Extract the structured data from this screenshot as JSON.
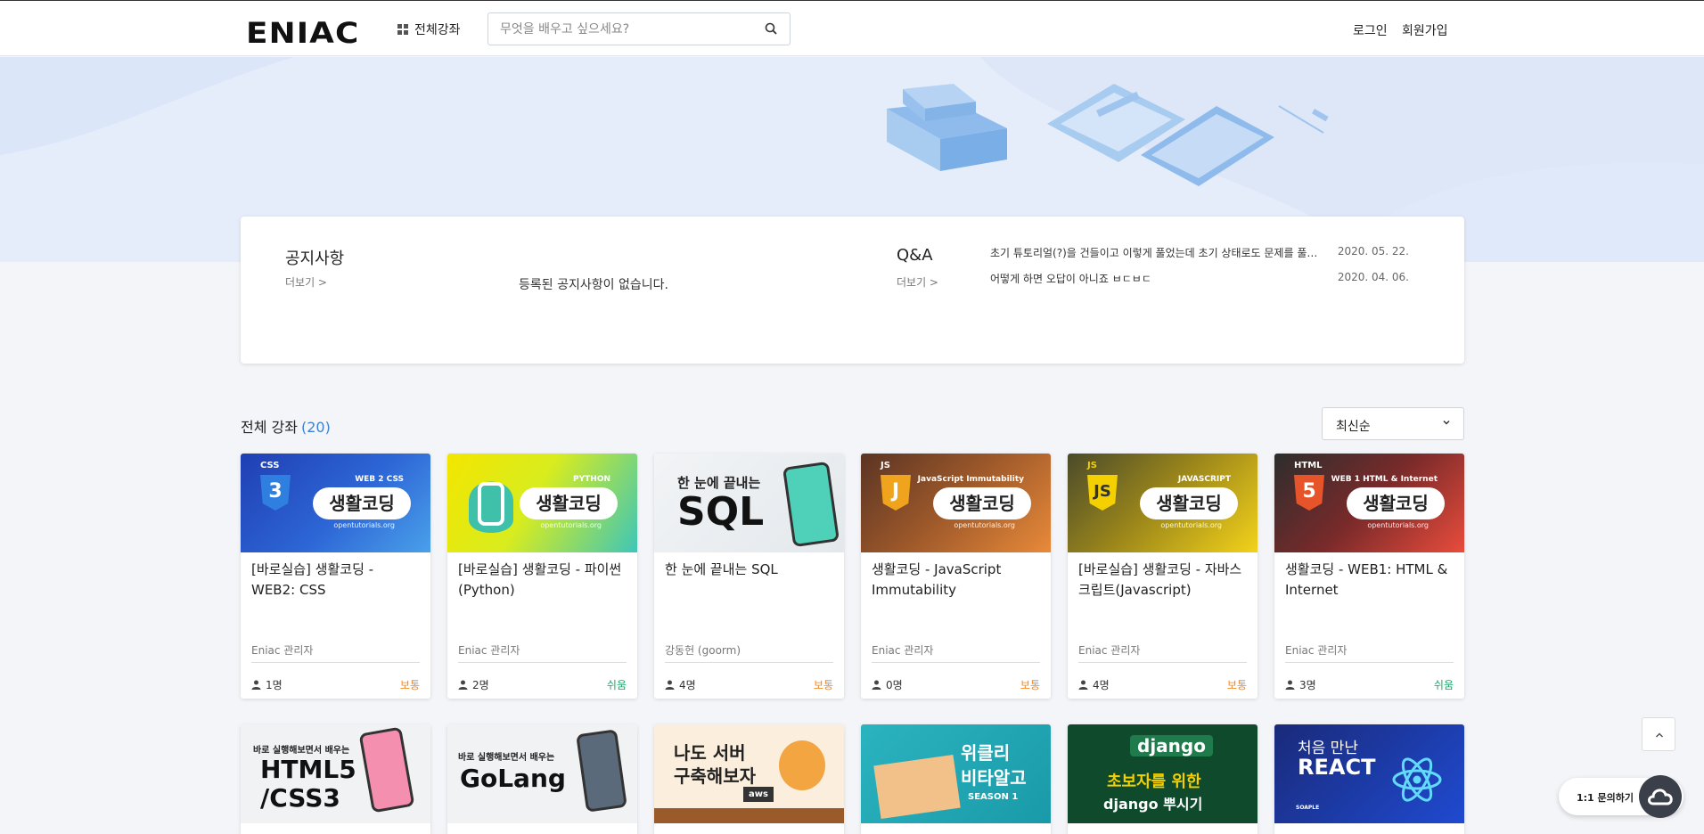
{
  "header": {
    "logo": "ENIAC",
    "all_courses_label": "전체강좌",
    "search_placeholder": "무엇을 배우고 싶으세요?",
    "login_label": "로그인",
    "signup_label": "회원가입"
  },
  "notice": {
    "title": "공지사항",
    "more_label": "더보기  >",
    "empty_message": "등록된 공지사항이 없습니다."
  },
  "qa": {
    "title": "Q&A",
    "more_label": "더보기  >",
    "items": [
      {
        "title": "초기 튜토리얼(?)을 건들이고 이렇게 풀었는데 초기 상태로도 문제를 풀 수 있나요?",
        "date": "2020. 05. 22."
      },
      {
        "title": "어떻게 하면 오답이 아니죠 ㅂㄷㅂㄷ",
        "date": "2020. 04. 06."
      }
    ]
  },
  "courses": {
    "section_title": "전체 강좌",
    "count": "(20)",
    "sort_label": "최신순",
    "items": [
      {
        "title": "[바로실습] 생활코딩 - WEB2: CSS",
        "author": "Eniac 관리자",
        "students": "1명",
        "level": "보통",
        "level_color": "#f08a24",
        "thumb": {
          "badge": "CSS",
          "glyph": "3",
          "sup": "WEB 2  CSS",
          "pill": "생활코딩",
          "sub": "opentutorials.org"
        }
      },
      {
        "title": "[바로실습] 생활코딩 - 파이썬 (Python)",
        "author": "Eniac 관리자",
        "students": "2명",
        "level": "쉬움",
        "level_color": "#1aa86a",
        "thumb": {
          "sup": "PYTHON",
          "pill": "생활코딩",
          "sub": "opentutorials.org"
        }
      },
      {
        "title": "한 눈에 끝내는 SQL",
        "author": "강동헌 (goorm)",
        "students": "4명",
        "level": "보통",
        "level_color": "#f08a24",
        "thumb": {
          "line1": "한 눈에 끝내는",
          "line2": "SQL"
        }
      },
      {
        "title": "생활코딩 - JavaScript Immutability",
        "author": "Eniac 관리자",
        "students": "0명",
        "level": "보통",
        "level_color": "#f08a24",
        "thumb": {
          "badge": "JS",
          "glyph": "J",
          "sup": "JavaScript  Immutability",
          "pill": "생활코딩",
          "sub": "opentutorials.org"
        }
      },
      {
        "title": "[바로실습] 생활코딩 - 자바스크립트(Javascript)",
        "author": "Eniac 관리자",
        "students": "4명",
        "level": "보통",
        "level_color": "#f08a24",
        "thumb": {
          "badge": "JS",
          "glyph": "JS",
          "sup": "JAVASCRIPT",
          "pill": "생활코딩",
          "sub": "opentutorials.org"
        }
      },
      {
        "title": "생활코딩 - WEB1: HTML & Internet",
        "author": "Eniac 관리자",
        "students": "3명",
        "level": "쉬움",
        "level_color": "#1aa86a",
        "thumb": {
          "badge": "HTML",
          "glyph": "5",
          "sup": "WEB 1  HTML & Internet",
          "pill": "생활코딩",
          "sub": "opentutorials.org"
        }
      }
    ],
    "row2": [
      {
        "line1": "바로 실행해보면서 배우는",
        "line2": "HTML5",
        "line3": "/CSS3"
      },
      {
        "line1": "바로 실행해보면서 배우는",
        "line2": "GoLang"
      },
      {
        "line1": "나도 서버",
        "line2": "구축해보자",
        "line3": "aws"
      },
      {
        "line1": "위클리",
        "line2": "비타알고",
        "line3": "SEASON 1"
      },
      {
        "line1": "django",
        "line2": "초보자를 위한",
        "line3": "django 뿌시기"
      },
      {
        "line1": "처음 만난",
        "line2": "REACT",
        "line3": "SOAPLE"
      }
    ]
  },
  "floating": {
    "chat_label": "1:1 문의하기"
  }
}
